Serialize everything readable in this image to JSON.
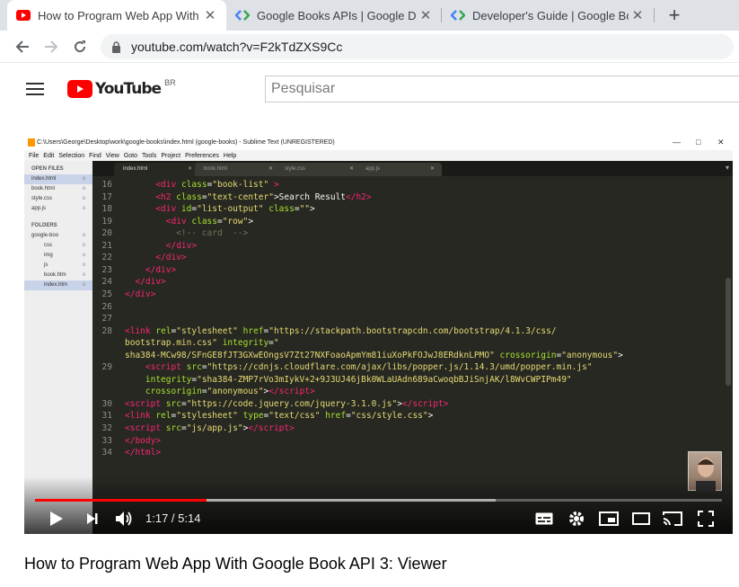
{
  "browser": {
    "tabs": [
      {
        "title": "How to Program Web App With Google Book",
        "active": true
      },
      {
        "title": "Google Books APIs  |  Google Developers",
        "active": false
      },
      {
        "title": "Developer's Guide  |  Google Books APIs",
        "active": false
      }
    ],
    "url": "youtube.com/watch?v=F2kTdZXS9Cc"
  },
  "youtube": {
    "logo": "YouTube",
    "country": "BR",
    "search_placeholder": "Pesquisar"
  },
  "video": {
    "sublime_title": "C:\\Users\\George\\Desktop\\work\\google-books\\index.html (google-books) - Sublime Text (UNREGISTERED)",
    "menu": [
      "File",
      "Edit",
      "Selection",
      "Find",
      "View",
      "Goto",
      "Tools",
      "Project",
      "Preferences",
      "Help"
    ],
    "sidebar": {
      "open_files_label": "OPEN FILES",
      "open_files": [
        "index.html",
        "book.html",
        "style.css",
        "app.js"
      ],
      "folders_label": "FOLDERS",
      "folders": [
        "google-boo",
        "css",
        "img",
        "js",
        "book.htm",
        "index.htm"
      ]
    },
    "editor_tabs": [
      "index.html",
      "book.html",
      "style.css",
      "app.js"
    ],
    "code_lines": [
      {
        "num": "16",
        "html": "      <span class='tag'>&lt;div</span> <span class='attr'>class</span>=<span class='str'>\"book-list\"</span> <span class='tag'>&gt;</span>"
      },
      {
        "num": "17",
        "html": "      <span class='tag'>&lt;h2</span> <span class='attr'>class</span>=<span class='str'>\"text-center\"</span>&gt;Search Result<span class='tag'>&lt;/h2&gt;</span>"
      },
      {
        "num": "18",
        "html": "      <span class='tag'>&lt;div</span> <span class='attr'>id</span>=<span class='str'>\"list-output\"</span> <span class='attr'>class</span>=<span class='str'>\"\"</span>&gt;"
      },
      {
        "num": "19",
        "html": "        <span class='tag'>&lt;div</span> <span class='attr'>class</span>=<span class='str'>\"row\"</span>&gt;"
      },
      {
        "num": "20",
        "html": "          <span class='cmt'>&lt;!-- card  --&gt;</span>"
      },
      {
        "num": "21",
        "html": "        <span class='tag'>&lt;/div&gt;</span>"
      },
      {
        "num": "22",
        "html": "      <span class='tag'>&lt;/div&gt;</span>"
      },
      {
        "num": "23",
        "html": "    <span class='tag'>&lt;/div&gt;</span>"
      },
      {
        "num": "24",
        "html": "  <span class='tag'>&lt;/div&gt;</span>"
      },
      {
        "num": "25",
        "html": "<span class='tag'>&lt;/div&gt;</span>"
      },
      {
        "num": "26",
        "html": ""
      },
      {
        "num": "27",
        "html": ""
      },
      {
        "num": "28",
        "html": "<span class='tag'>&lt;link</span> <span class='attr'>rel</span>=<span class='str'>\"stylesheet\"</span> <span class='attr'>href</span>=<span class='str'>\"https://stackpath.bootstrapcdn.com/bootstrap/4.1.3/css/</span>"
      },
      {
        "num": "",
        "html": "<span class='str'>bootstrap.min.css\"</span> <span class='attr'>integrity</span>=<span class='str'>\"</span>"
      },
      {
        "num": "",
        "html": "<span class='str'>sha384-MCw98/SFnGE8fJT3GXwEOngsV7Zt27NXFoaoApmYm81iuXoPkFOJwJ8ERdknLPMO\"</span> <span class='attr'>crossorigin</span>=<span class='str'>\"anonymous\"</span>&gt;"
      },
      {
        "num": "29",
        "html": "    <span class='tag'>&lt;script</span> <span class='attr'>src</span>=<span class='str'>\"https://cdnjs.cloudflare.com/ajax/libs/popper.js/1.14.3/umd/popper.min.js\"</span>"
      },
      {
        "num": "",
        "html": "    <span class='attr'>integrity</span>=<span class='str'>\"sha384-ZMP7rVo3mIykV+2+9J3UJ46jBk0WLaUAdn689aCwoqbBJiSnjAK/l8WvCWPIPm49\"</span>"
      },
      {
        "num": "",
        "html": "    <span class='attr'>crossorigin</span>=<span class='str'>\"anonymous\"</span>&gt;<span class='tag'>&lt;/script&gt;</span>"
      },
      {
        "num": "30",
        "html": "<span class='tag'>&lt;script</span> <span class='attr'>src</span>=<span class='str'>\"https://code.jquery.com/jquery-3.1.0.js\"</span>&gt;<span class='tag'>&lt;/script&gt;</span>"
      },
      {
        "num": "31",
        "html": "<span class='tag'>&lt;link</span> <span class='attr'>rel</span>=<span class='str'>\"stylesheet\"</span> <span class='attr'>type</span>=<span class='str'>\"text/css\"</span> <span class='attr'>href</span>=<span class='str'>\"css/style.css\"</span>&gt;"
      },
      {
        "num": "32",
        "html": "<span class='tag'>&lt;script</span> <span class='attr'>src</span>=<span class='str'>\"js/app.js\"</span>&gt;<span class='tag'>&lt;/script&gt;</span>"
      },
      {
        "num": "33",
        "html": "<span class='tag'>&lt;/body&gt;</span>"
      },
      {
        "num": "34",
        "html": "<span class='tag'>&lt;/html&gt;</span>"
      }
    ],
    "time": "1:17 / 5:14",
    "progress_played": 0.25,
    "progress_buffered": 0.67,
    "title": "How to Program Web App With Google Book API 3: Viewer"
  },
  "colors": {
    "yt_red": "#ff0000",
    "editor_bg": "#272822"
  }
}
